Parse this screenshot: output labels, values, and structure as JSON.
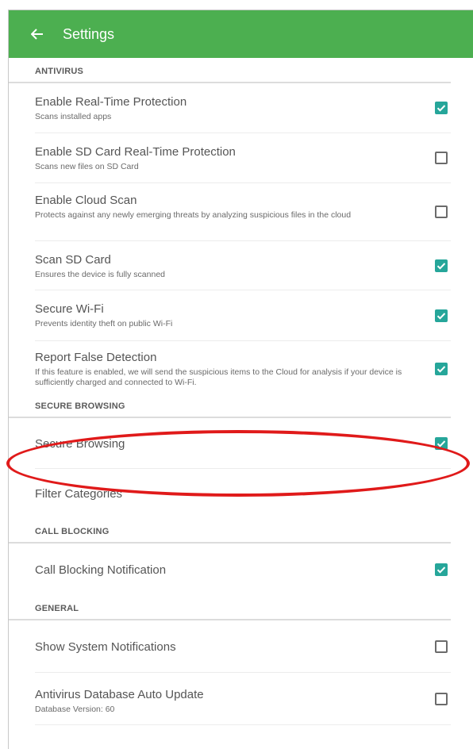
{
  "appbar": {
    "title": "Settings",
    "back_icon": "back-arrow-icon"
  },
  "colors": {
    "appbar": "#4caf50",
    "checkbox_on": "#26a69a",
    "highlight": "#e01a1a"
  },
  "antivirus": {
    "header": "ANTIVIRUS",
    "items": [
      {
        "title": "Enable Real-Time Protection",
        "subtitle": "Scans installed apps",
        "checked": true
      },
      {
        "title": "Enable SD Card Real-Time Protection",
        "subtitle": "Scans new files on SD Card",
        "checked": false
      },
      {
        "title": "Enable Cloud Scan",
        "subtitle": "Protects against any newly emerging threats by analyzing suspicious files in the cloud",
        "checked": false
      },
      {
        "title": "Scan SD Card",
        "subtitle": "Ensures the device is fully scanned",
        "checked": true
      },
      {
        "title": "Secure Wi-Fi",
        "subtitle": "Prevents identity theft on public Wi-Fi",
        "checked": true
      },
      {
        "title": "Report False Detection",
        "subtitle": "If this feature is enabled, we will send the suspicious items to the Cloud for analysis if your device is sufficiently charged and connected to Wi-Fi.",
        "checked": true
      }
    ]
  },
  "secure_browsing": {
    "header": "SECURE BROWSING",
    "items": [
      {
        "title": "Secure Browsing",
        "checked": true
      },
      {
        "title": "Filter Categories"
      }
    ]
  },
  "call_blocking": {
    "header": "CALL BLOCKING",
    "items": [
      {
        "title": "Call Blocking Notification",
        "checked": true
      }
    ]
  },
  "general": {
    "header": "GENERAL",
    "items": [
      {
        "title": "Show System Notifications",
        "checked": false
      },
      {
        "title": "Antivirus Database Auto Update",
        "subtitle": "Database Version: 60",
        "checked": false
      }
    ]
  }
}
